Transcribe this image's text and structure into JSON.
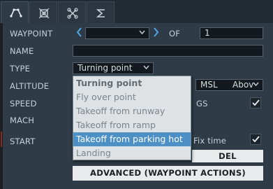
{
  "tabs": [
    {
      "icon": "route-icon",
      "active": true
    },
    {
      "icon": "target-icon",
      "active": false
    },
    {
      "icon": "gimbal-icon",
      "active": false
    },
    {
      "icon": "sigma-icon",
      "active": false
    }
  ],
  "labels": {
    "waypoint": "WAYPOINT",
    "of": "OF",
    "name": "NAME",
    "type": "TYPE",
    "altitude": "ALTITUDE",
    "speed": "SPEED",
    "mach": "MACH",
    "start": "START"
  },
  "waypoint": {
    "selected": "",
    "total": "1"
  },
  "name_value": "",
  "type_selected": "Turning point",
  "type_options": [
    "Turning point",
    "Fly over point",
    "Takeoff from runway",
    "Takeoff from ramp",
    "Takeoff from parking hot",
    "Landing"
  ],
  "highlighted_option": "Takeoff from parking hot",
  "altitude": {
    "reference": "MSL",
    "mode": "Abov"
  },
  "speed": {
    "gs_label": "GS",
    "gs_checked": true
  },
  "start": {
    "fix_time_label": "Fix time",
    "fix_time_checked": true
  },
  "buttons": {
    "del": "DEL",
    "advanced": "ADVANCED (WAYPOINT ACTIONS)"
  },
  "colors": {
    "panel": "#2f3c47",
    "accent_arrow": "#4fa7e8",
    "highlight": "#4d90c6",
    "side_marker": "#8a2a1c"
  }
}
